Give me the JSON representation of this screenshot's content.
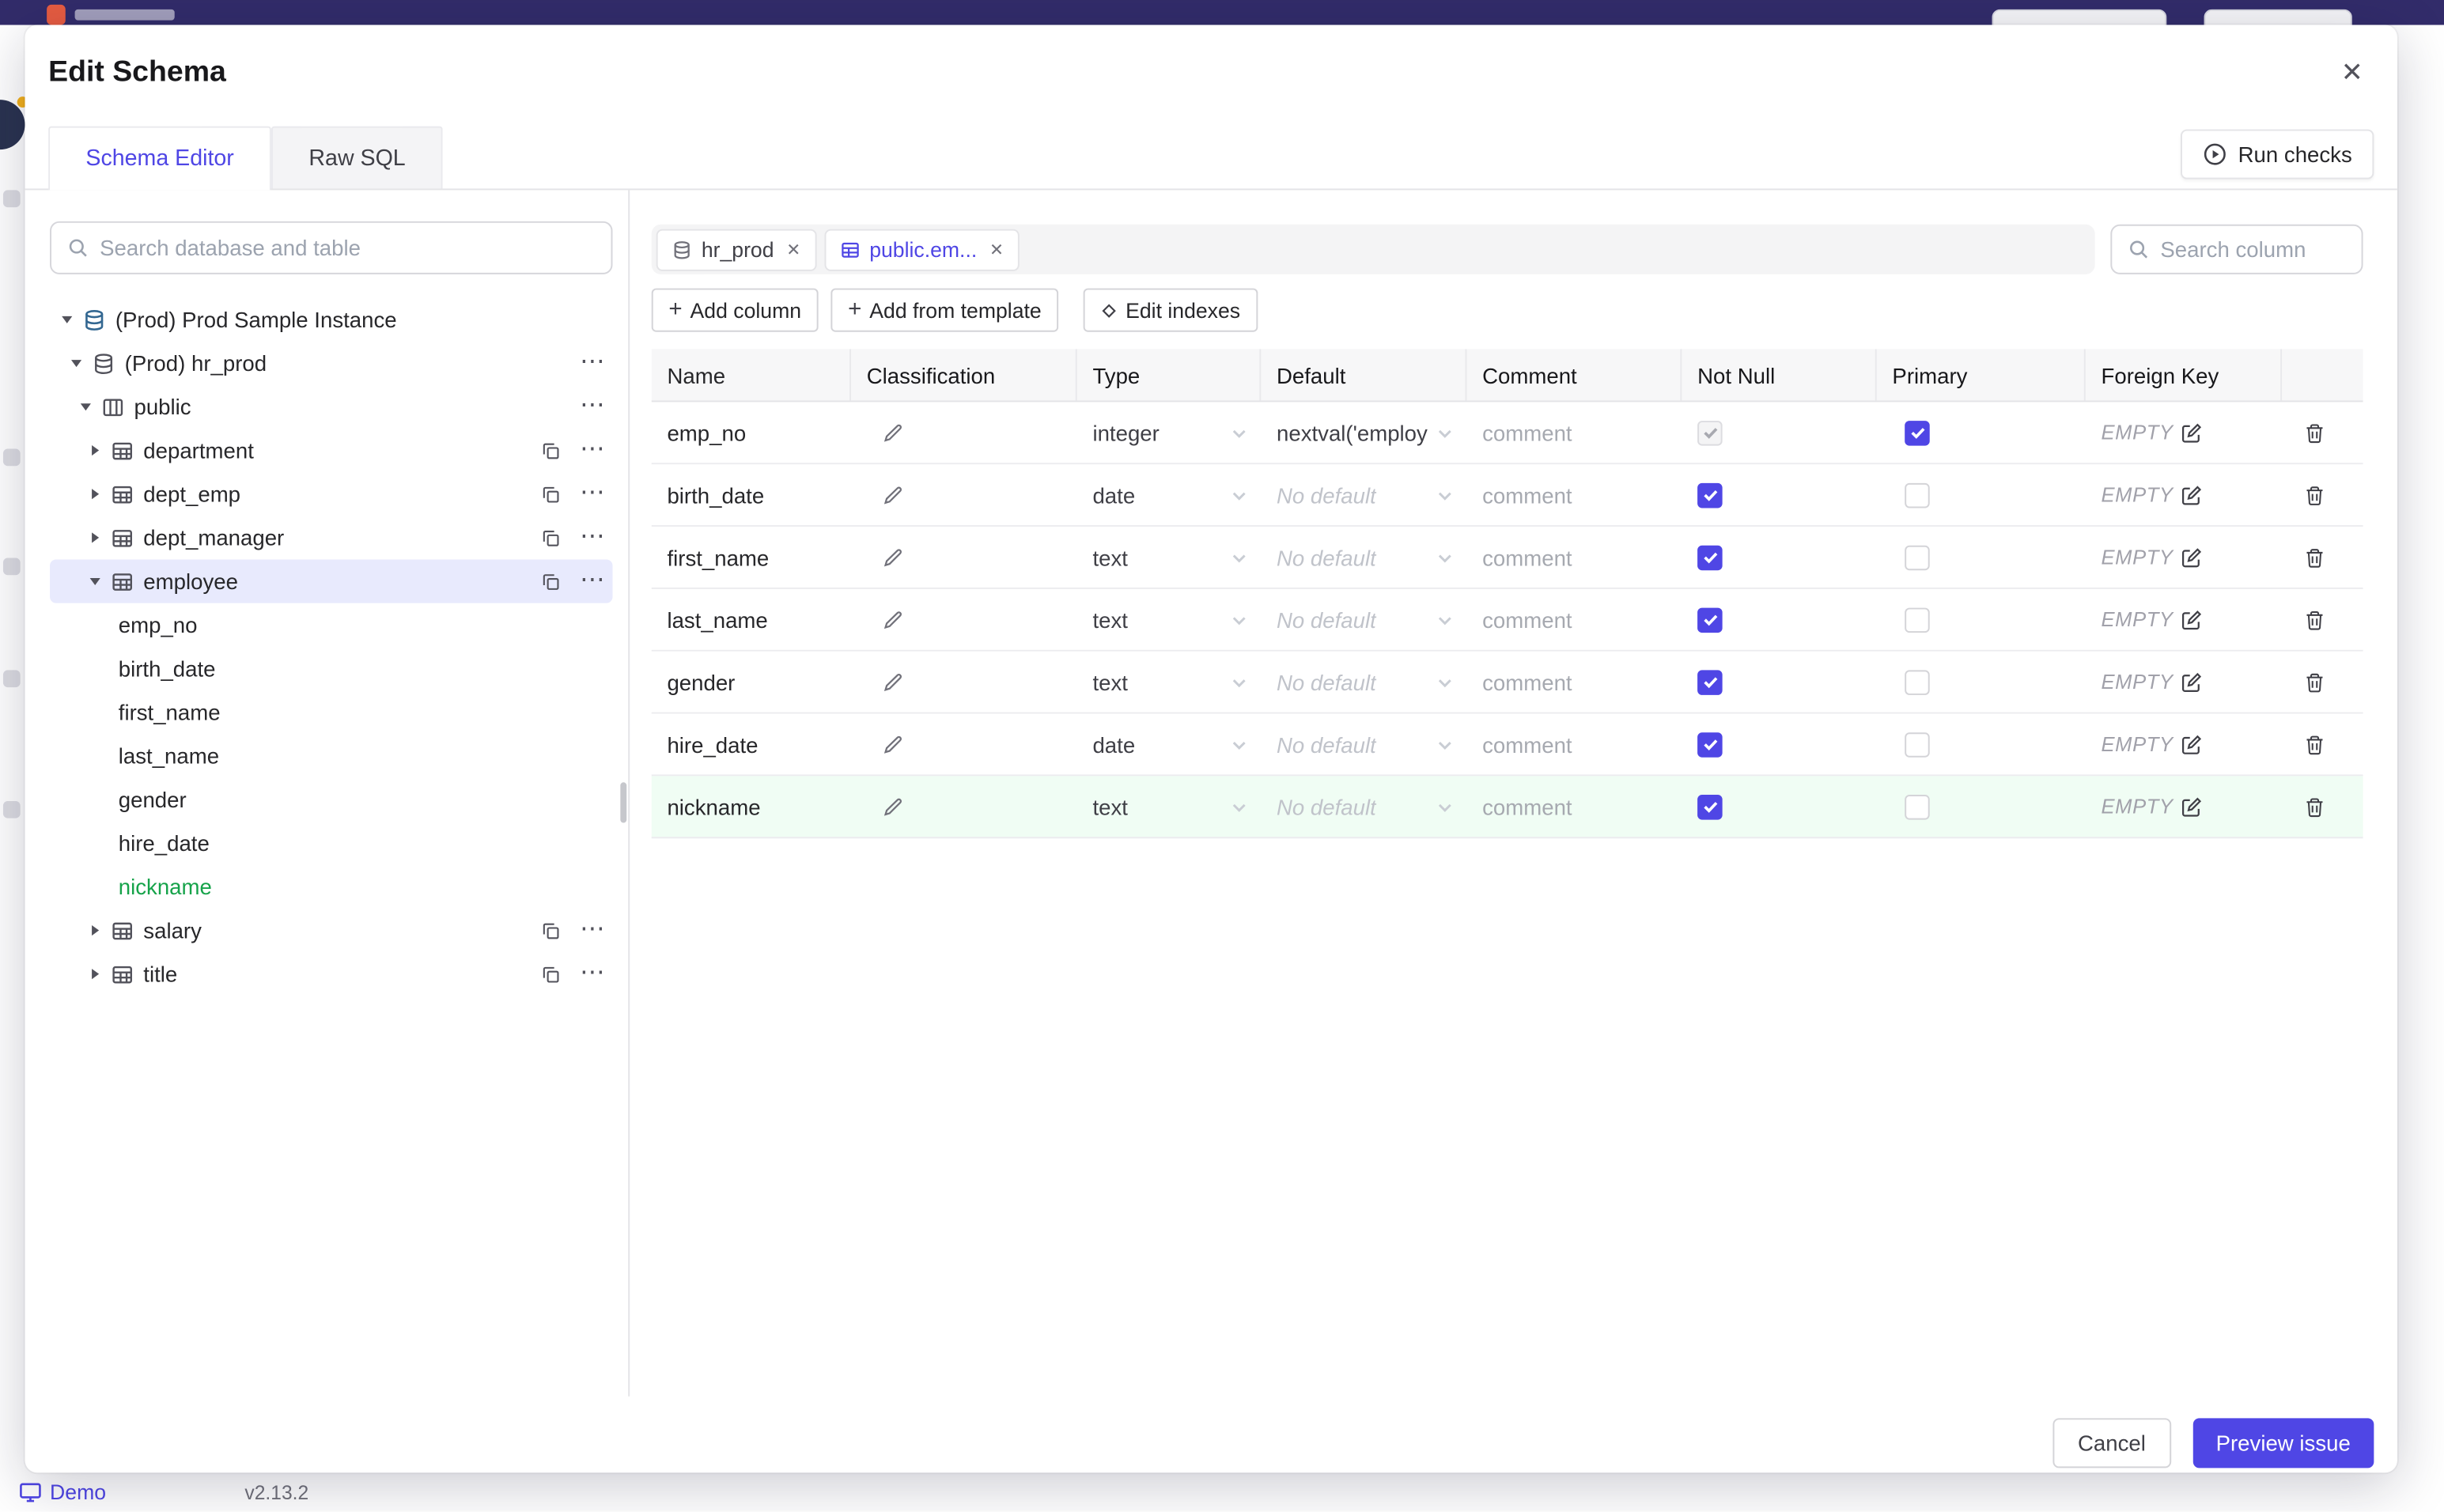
{
  "colors": {
    "accent": "#4f46e5",
    "selected_tree_bg": "#e8eafd",
    "new_item_green": "#16a34a",
    "new_row_bg": "#f0fdf4",
    "topbar_bg": "#322c6a"
  },
  "page": {
    "footer": {
      "demo_label": "Demo",
      "version": "v2.13.2"
    }
  },
  "modal": {
    "title": "Edit Schema",
    "tabs": [
      {
        "label": "Schema Editor",
        "active": true
      },
      {
        "label": "Raw SQL",
        "active": false
      }
    ],
    "run_checks_label": "Run checks",
    "sidebar": {
      "search_placeholder": "Search database and table",
      "tree": [
        {
          "label": "(Prod) Prod Sample Instance",
          "kind": "instance",
          "level": 0,
          "chevron": "down"
        },
        {
          "label": "(Prod) hr_prod",
          "kind": "database",
          "level": 1,
          "chevron": "down",
          "menu": true
        },
        {
          "label": "public",
          "kind": "schema",
          "level": 2,
          "chevron": "down",
          "menu": true
        },
        {
          "label": "department",
          "kind": "table",
          "level": 3,
          "chevron": "right",
          "copy": true,
          "menu": true
        },
        {
          "label": "dept_emp",
          "kind": "table",
          "level": 3,
          "chevron": "right",
          "copy": true,
          "menu": true
        },
        {
          "label": "dept_manager",
          "kind": "table",
          "level": 3,
          "chevron": "right",
          "copy": true,
          "menu": true
        },
        {
          "label": "employee",
          "kind": "table",
          "level": 3,
          "chevron": "down",
          "copy": true,
          "menu": true,
          "selected": true
        },
        {
          "label": "emp_no",
          "kind": "column",
          "level": 4
        },
        {
          "label": "birth_date",
          "kind": "column",
          "level": 4
        },
        {
          "label": "first_name",
          "kind": "column",
          "level": 4
        },
        {
          "label": "last_name",
          "kind": "column",
          "level": 4
        },
        {
          "label": "gender",
          "kind": "column",
          "level": 4
        },
        {
          "label": "hire_date",
          "kind": "column",
          "level": 4
        },
        {
          "label": "nickname",
          "kind": "column",
          "level": 4,
          "new_item": true
        },
        {
          "label": "salary",
          "kind": "table",
          "level": 3,
          "chevron": "right",
          "copy": true,
          "menu": true
        },
        {
          "label": "title",
          "kind": "table",
          "level": 3,
          "chevron": "right",
          "copy": true,
          "menu": true
        }
      ]
    },
    "main": {
      "chips": [
        {
          "label": "hr_prod",
          "kind": "database",
          "active": false
        },
        {
          "label": "public.em...",
          "kind": "table",
          "active": true
        }
      ],
      "column_search_placeholder": "Search column",
      "toolbar": {
        "add_column": "Add column",
        "add_from_template": "Add from template",
        "edit_indexes": "Edit indexes"
      },
      "table": {
        "headers": [
          "Name",
          "Classification",
          "Type",
          "Default",
          "Comment",
          "Not Null",
          "Primary",
          "Foreign Key"
        ],
        "rows": [
          {
            "name": "emp_no",
            "type": "integer",
            "default": "nextval('employ",
            "default_placeholder": false,
            "comment_placeholder": "comment",
            "not_null": "checked_disabled",
            "primary": "checked",
            "foreign_key": "EMPTY",
            "highlighted": false
          },
          {
            "name": "birth_date",
            "type": "date",
            "default": "No default",
            "default_placeholder": true,
            "comment_placeholder": "comment",
            "not_null": "checked",
            "primary": "unchecked",
            "foreign_key": "EMPTY",
            "highlighted": false
          },
          {
            "name": "first_name",
            "type": "text",
            "default": "No default",
            "default_placeholder": true,
            "comment_placeholder": "comment",
            "not_null": "checked",
            "primary": "unchecked",
            "foreign_key": "EMPTY",
            "highlighted": false
          },
          {
            "name": "last_name",
            "type": "text",
            "default": "No default",
            "default_placeholder": true,
            "comment_placeholder": "comment",
            "not_null": "checked",
            "primary": "unchecked",
            "foreign_key": "EMPTY",
            "highlighted": false
          },
          {
            "name": "gender",
            "type": "text",
            "default": "No default",
            "default_placeholder": true,
            "comment_placeholder": "comment",
            "not_null": "checked",
            "primary": "unchecked",
            "foreign_key": "EMPTY",
            "highlighted": false
          },
          {
            "name": "hire_date",
            "type": "date",
            "default": "No default",
            "default_placeholder": true,
            "comment_placeholder": "comment",
            "not_null": "checked",
            "primary": "unchecked",
            "foreign_key": "EMPTY",
            "highlighted": false
          },
          {
            "name": "nickname",
            "type": "text",
            "default": "No default",
            "default_placeholder": true,
            "comment_placeholder": "comment",
            "not_null": "checked",
            "primary": "unchecked",
            "foreign_key": "EMPTY",
            "highlighted": true
          }
        ]
      }
    },
    "footer": {
      "cancel_label": "Cancel",
      "primary_label": "Preview issue"
    }
  }
}
